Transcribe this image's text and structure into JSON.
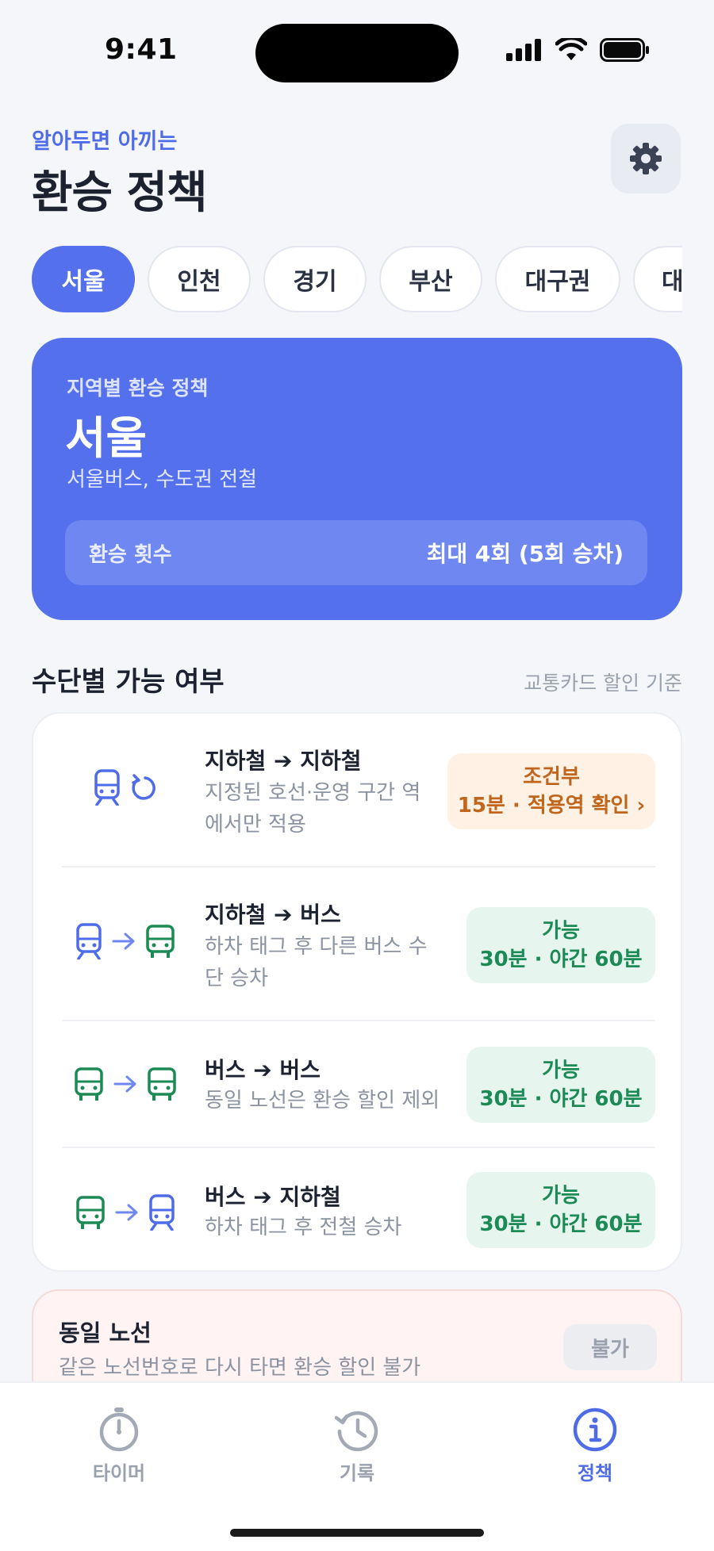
{
  "status_bar": {
    "time": "9:41"
  },
  "header": {
    "eyebrow": "알아두면 아끼는",
    "title": "환승 정책"
  },
  "regions": [
    "서울",
    "인천",
    "경기",
    "부산",
    "대구권",
    "대"
  ],
  "selected_region_index": 0,
  "hero": {
    "label": "지역별 환승 정책",
    "city": "서울",
    "description": "서울버스, 수도권 전철",
    "transfer_count_label": "환승 횟수",
    "transfer_count_value": "최대 4회 (5회 승차)"
  },
  "section": {
    "title": "수단별 가능 여부",
    "note": "교통카드 할인 기준"
  },
  "rules": [
    {
      "title": "지하철 ➔ 지하철",
      "desc": "지정된 호선·운영 구간 역에서만 적용",
      "status": "조건부",
      "detail": "15분 · 적용역 확인 ›",
      "from_icon": "subway-icon",
      "to_icon": "refresh-icon"
    },
    {
      "title": "지하철 ➔ 버스",
      "desc": "하차 태그 후 다른 버스 수단 승차",
      "status": "가능",
      "detail": "30분 · 야간 60분",
      "from_icon": "subway-icon",
      "to_icon": "bus-icon"
    },
    {
      "title": "버스 ➔ 버스",
      "desc": "동일 노선은 환승 할인 제외",
      "status": "가능",
      "detail": "30분 · 야간 60분",
      "from_icon": "bus-icon",
      "to_icon": "bus-icon"
    },
    {
      "title": "버스 ➔ 지하철",
      "desc": "하차 태그 후 전철 승차",
      "status": "가능",
      "detail": "30분 · 야간 60분",
      "from_icon": "bus-icon",
      "to_icon": "subway-icon"
    }
  ],
  "same_route": {
    "title": "동일 노선",
    "desc": "같은 노선번호로 다시 타면 환승 할인 불가",
    "badge": "불가"
  },
  "tabs": [
    {
      "label": "타이머",
      "icon": "stopwatch-icon"
    },
    {
      "label": "기록",
      "icon": "history-icon"
    },
    {
      "label": "정책",
      "icon": "info-icon"
    }
  ],
  "active_tab_index": 2,
  "colors": {
    "accent": "#5470EC",
    "subway": "#4E6CE8",
    "bus": "#1C8A55",
    "conditional": "#C0651B"
  }
}
